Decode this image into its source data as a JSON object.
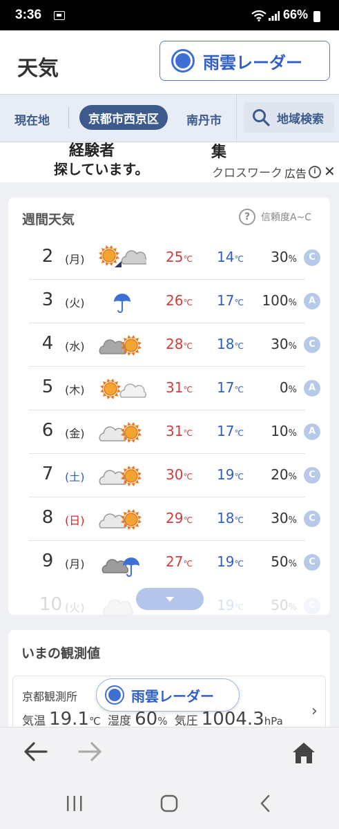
{
  "status": {
    "time": "3:36",
    "battery": "66%"
  },
  "header": {
    "title": "天気",
    "radar_label": "雨雲レーダー"
  },
  "locations": {
    "current": "現在地",
    "selected": "京都市西京区",
    "other": "南丹市",
    "search_label": "地域検索"
  },
  "ad": {
    "line1": "経験者",
    "line2": "探しています。",
    "line3": "集",
    "line4": "クロスワーク",
    "ad_label": "広告"
  },
  "weekly": {
    "title": "週間天気",
    "reliability_label": "信頼度A~C",
    "temp_unit": "℃",
    "pop_unit": "%",
    "rows": [
      {
        "day": "2",
        "dow": "(月)",
        "icon": "sunny-then-cloudy-icon",
        "hi": "25",
        "lo": "14",
        "pop": "30",
        "grade": "C"
      },
      {
        "day": "3",
        "dow": "(火)",
        "icon": "rain-icon",
        "hi": "26",
        "lo": "17",
        "pop": "100",
        "grade": "A"
      },
      {
        "day": "4",
        "dow": "(水)",
        "icon": "cloudy-sometimes-sunny-icon",
        "hi": "28",
        "lo": "18",
        "pop": "30",
        "grade": "C"
      },
      {
        "day": "5",
        "dow": "(木)",
        "icon": "sunny-sometimes-cloudy-icon",
        "hi": "31",
        "lo": "17",
        "pop": "0",
        "grade": "A"
      },
      {
        "day": "6",
        "dow": "(金)",
        "icon": "cloudy-sometimes-sunny-icon",
        "hi": "31",
        "lo": "17",
        "pop": "10",
        "grade": "A"
      },
      {
        "day": "7",
        "dow": "(土)",
        "icon": "cloudy-sometimes-sunny-icon",
        "hi": "30",
        "lo": "19",
        "pop": "20",
        "grade": "C"
      },
      {
        "day": "8",
        "dow": "(日)",
        "icon": "cloudy-sometimes-sunny-icon",
        "hi": "29",
        "lo": "18",
        "pop": "30",
        "grade": "C"
      },
      {
        "day": "9",
        "dow": "(月)",
        "icon": "cloudy-sometimes-rain-icon",
        "hi": "27",
        "lo": "19",
        "pop": "50",
        "grade": "C"
      },
      {
        "day": "10",
        "dow": "(火)",
        "icon": "cloudy-icon",
        "hi": "",
        "lo": "19",
        "pop": "50",
        "grade": "C"
      }
    ]
  },
  "observation": {
    "title": "いまの観測値",
    "station": "京都観測所",
    "temp_label": "気温",
    "temp_value": "19.1",
    "temp_unit": "℃",
    "humidity_label": "湿度",
    "humidity_value": "60",
    "humidity_unit": "%",
    "pressure_label": "気圧",
    "pressure_value": "1004.3",
    "pressure_unit": "hPa"
  },
  "floating": {
    "radar_label": "雨雲レーダー"
  },
  "colors": {
    "accent": "#3d5a8c",
    "radar_blue": "#2f5fc4",
    "hi_temp": "#d23c3c",
    "lo_temp": "#2f5fc4",
    "grade_bg": "#b6c9e9"
  }
}
